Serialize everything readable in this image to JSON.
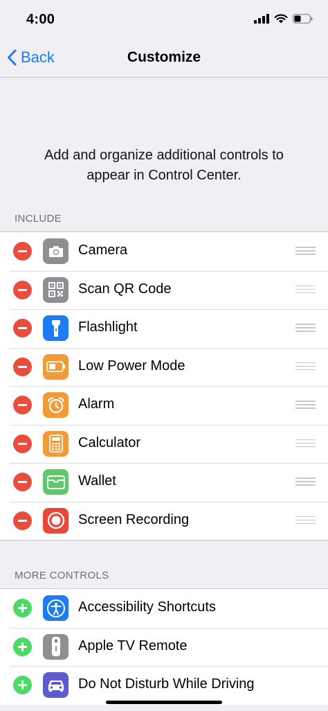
{
  "status_bar": {
    "time": "4:00"
  },
  "nav": {
    "back_label": "Back",
    "title": "Customize"
  },
  "intro": {
    "text": "Add and organize additional controls to appear in Control Center."
  },
  "include": {
    "header": "INCLUDE",
    "items": [
      {
        "label": "Camera",
        "icon": "camera-icon",
        "color": "#8e8e93"
      },
      {
        "label": "Scan QR Code",
        "icon": "qr-code-icon",
        "color": "#8e8e93"
      },
      {
        "label": "Flashlight",
        "icon": "flashlight-icon",
        "color": "#1c7cf5"
      },
      {
        "label": "Low Power Mode",
        "icon": "battery-icon",
        "color": "#f19a37"
      },
      {
        "label": "Alarm",
        "icon": "alarm-clock-icon",
        "color": "#f19a37"
      },
      {
        "label": "Calculator",
        "icon": "calculator-icon",
        "color": "#f19a37"
      },
      {
        "label": "Wallet",
        "icon": "wallet-icon",
        "color": "#5ec86b"
      },
      {
        "label": "Screen Recording",
        "icon": "screen-recording-icon",
        "color": "#e9473a"
      }
    ]
  },
  "more_controls": {
    "header": "MORE CONTROLS",
    "items": [
      {
        "label": "Accessibility Shortcuts",
        "icon": "accessibility-icon",
        "color": "#1c7cf5"
      },
      {
        "label": "Apple TV Remote",
        "icon": "tv-remote-icon",
        "color": "#8e8e93"
      },
      {
        "label": "Do Not Disturb While Driving",
        "icon": "car-icon",
        "color": "#5d5ccd"
      }
    ]
  }
}
